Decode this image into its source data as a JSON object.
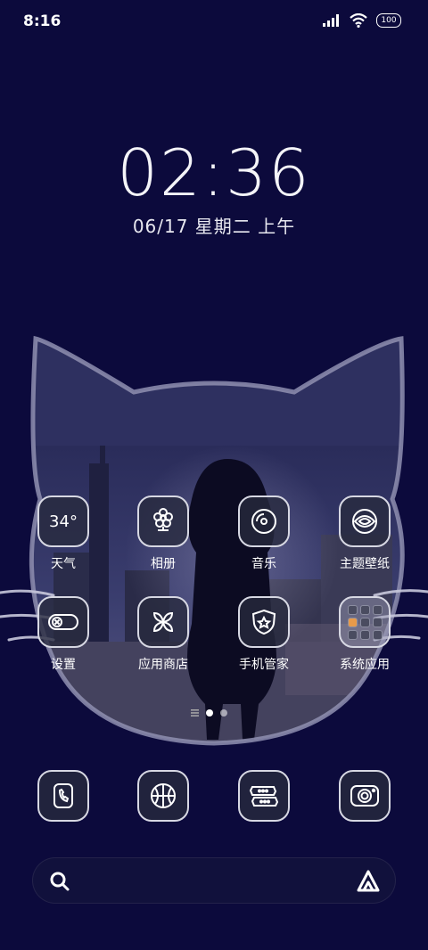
{
  "status_bar": {
    "time": "8:16",
    "battery": "100",
    "icons": [
      "signal-icon",
      "wifi-icon",
      "battery-icon"
    ]
  },
  "clock": {
    "time": "02:36",
    "date": "06/17 星期二 上午"
  },
  "weather": {
    "temperature": "34°"
  },
  "apps_row1": [
    {
      "label": "天气",
      "icon": "weather-icon"
    },
    {
      "label": "相册",
      "icon": "flower-icon"
    },
    {
      "label": "音乐",
      "icon": "disc-icon"
    },
    {
      "label": "主题壁纸",
      "icon": "theme-icon"
    }
  ],
  "apps_row2": [
    {
      "label": "设置",
      "icon": "toggle-icon"
    },
    {
      "label": "应用商店",
      "icon": "petals-icon"
    },
    {
      "label": "手机管家",
      "icon": "shield-star-icon"
    },
    {
      "label": "系统应用",
      "icon": "folder-icon"
    }
  ],
  "dock": [
    {
      "icon": "phone-icon"
    },
    {
      "icon": "browser-icon"
    },
    {
      "icon": "messages-icon"
    },
    {
      "icon": "camera-icon"
    }
  ],
  "page_indicator": {
    "pages": 2,
    "active": 1
  },
  "colors": {
    "background": "#0c0a3c",
    "icon_border": "#d7d8e3",
    "accent": "#e89a4a"
  }
}
